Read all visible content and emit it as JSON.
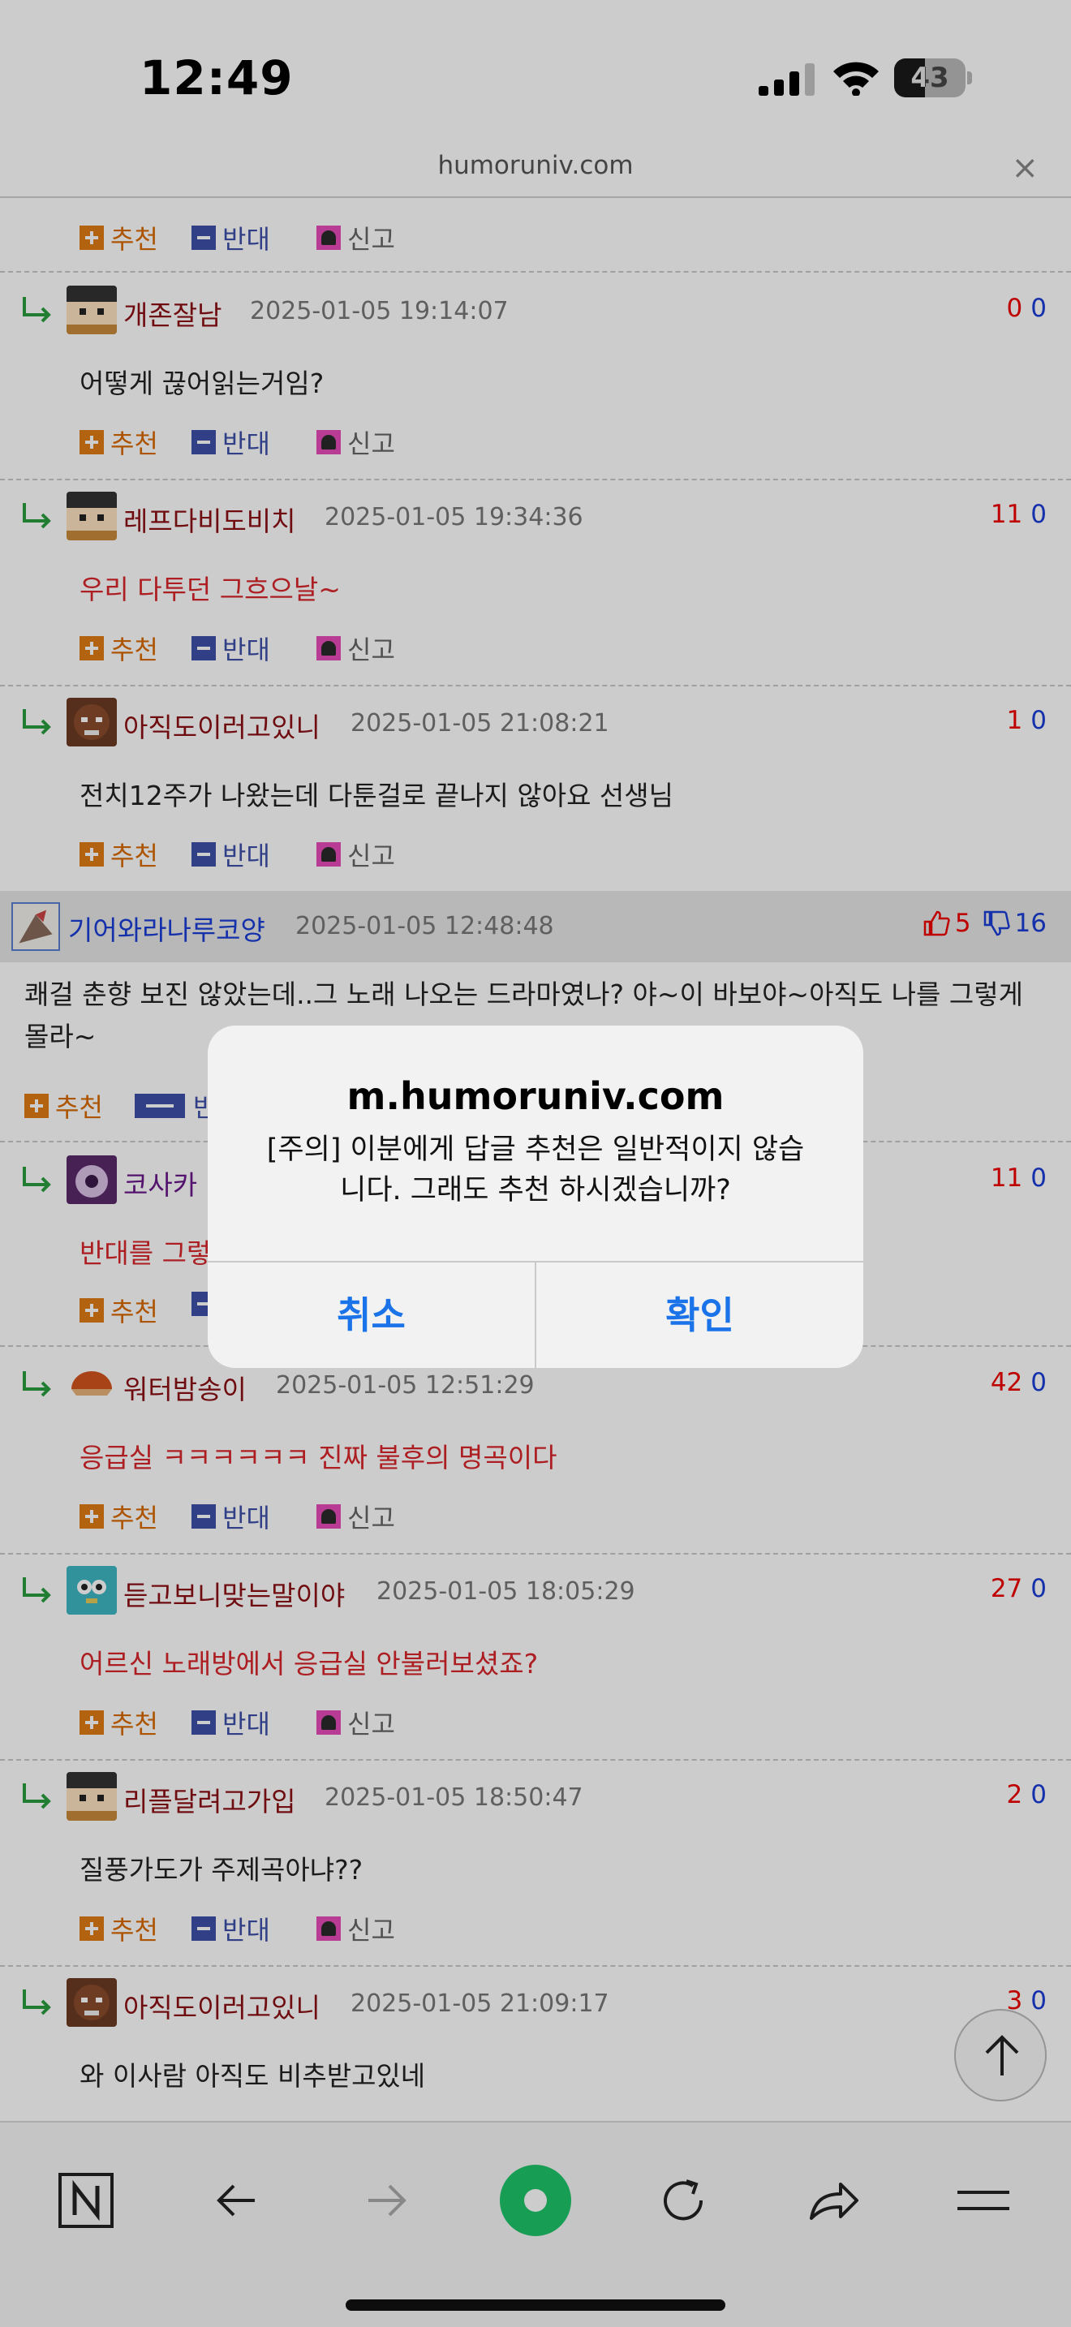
{
  "status_bar": {
    "time": "12:49",
    "battery_level": "43",
    "battery_fraction": 0.43
  },
  "url_bar": {
    "domain": "humoruniv.com",
    "close_label": "×"
  },
  "actions": {
    "recommend": "추천",
    "oppose": "반대",
    "report": "신고"
  },
  "replies_top": [
    {
      "nick": "개존잘남",
      "date": "2025-01-05 19:14:07",
      "up": "0",
      "down": "0",
      "text": "어떻게 끊어읽는거임?",
      "text_red": false
    },
    {
      "nick": "레프다비도비치",
      "date": "2025-01-05 19:34:36",
      "up": "11",
      "down": "0",
      "text": "우리 다투던 그흐으날~",
      "text_red": true
    },
    {
      "nick": "아직도이러고있니",
      "date": "2025-01-05 21:08:21",
      "up": "1",
      "down": "0",
      "text": "전치12주가 나왔는데 다툰걸로 끝나지 않아요 선생님",
      "text_red": false
    }
  ],
  "main_comment": {
    "nick": "기어와라나루코양",
    "date": "2025-01-05 12:48:48",
    "up": "5",
    "down": "16",
    "text": "쾌걸 춘향 보진 않았는데..그 노래 나오는 드라마였나? 야~이 바보야~아직도 나를 그렇게 몰라~",
    "recommend": "추천",
    "oppose_partial": "반"
  },
  "replies_bottom": [
    {
      "nick": "코사카",
      "date": "",
      "up": "11",
      "down": "0",
      "text": "반대를 그렇",
      "text_red": true
    },
    {
      "nick": "워터밤송이",
      "date": "2025-01-05 12:51:29",
      "up": "42",
      "down": "0",
      "text": "응급실 ㅋㅋㅋㅋㅋㅋ 진짜 불후의 명곡이다",
      "text_red": true
    },
    {
      "nick": "듣고보니맞는말이야",
      "date": "2025-01-05 18:05:29",
      "up": "27",
      "down": "0",
      "text": "어르신 노래방에서 응급실 안불러보셨죠?",
      "text_red": true
    },
    {
      "nick": "리플달려고가입",
      "date": "2025-01-05 18:50:47",
      "up": "2",
      "down": "0",
      "text": "질풍가도가 주제곡아냐??",
      "text_red": false
    },
    {
      "nick": "아직도이러고있니",
      "date": "2025-01-05 21:09:17",
      "up": "3",
      "down": "0",
      "text": "와 이사람 아직도 비추받고있네",
      "text_red": false
    }
  ],
  "alert": {
    "title": "m.humoruniv.com",
    "message": "[주의] 이분에게 답글 추천은 일반적이지 않습니다. 그래도 추천 하시겠습니까?",
    "cancel": "취소",
    "ok": "확인"
  },
  "colors": {
    "accent": "#1a73e8",
    "nick": "#8b0f14",
    "upvote": "#e00000",
    "downvote": "#1a3cd6",
    "recommend": "#d96a00",
    "oppose": "#3d4fa8"
  }
}
